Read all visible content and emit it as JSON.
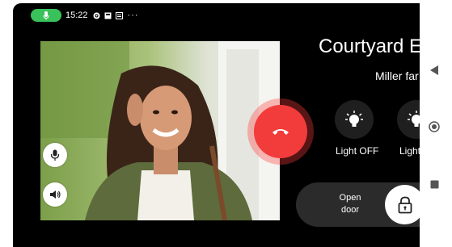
{
  "status_bar": {
    "time": "15:22",
    "icons": [
      "microphone-active-icon",
      "settings-icon",
      "notification-icon",
      "message-icon"
    ],
    "overflow": "···",
    "mic_pill_color": "#39c15a"
  },
  "call": {
    "title": "Courtyard E",
    "subtitle": "Miller far",
    "hangup_color": "#f23b3b"
  },
  "video_controls": {
    "mic_icon": "microphone-icon",
    "speaker_icon": "speaker-icon"
  },
  "lights": [
    {
      "label": "Light OFF",
      "icon": "light-bulb-icon"
    },
    {
      "label": "Light",
      "icon": "light-bulb-icon"
    }
  ],
  "door": {
    "open_line1": "Open",
    "open_line2": "door",
    "icon": "lock-icon"
  },
  "nav": {
    "buttons": [
      "back-icon",
      "home-icon",
      "recents-icon"
    ]
  }
}
